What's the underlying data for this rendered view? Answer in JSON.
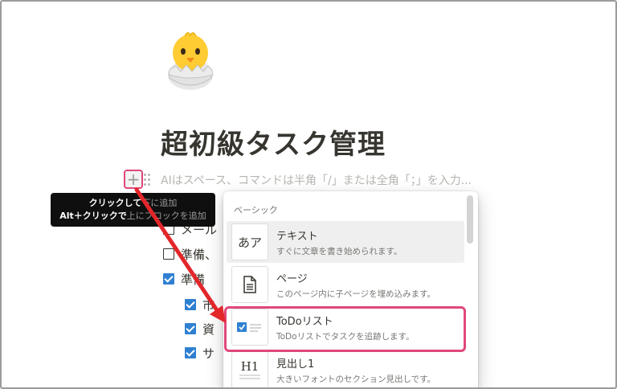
{
  "page": {
    "icon": "hatching-chick-icon",
    "title": "超初級タスク管理"
  },
  "editor": {
    "placeholder": "AIはスペース、コマンドは半角「/」または全角「；」を入力..."
  },
  "tooltip": {
    "line1_a": "クリックして",
    "line1_b": "下に追加",
    "line2_a": "Alt＋クリックで",
    "line2_b": "上にブロックを追加"
  },
  "todos": [
    {
      "text": "メール",
      "checked": false
    },
    {
      "text": "準備、",
      "checked": false
    },
    {
      "text": "準備",
      "checked": true
    },
    {
      "text": "市",
      "checked": true
    },
    {
      "text": "資",
      "checked": true
    },
    {
      "text": "サ",
      "checked": true
    }
  ],
  "menu": {
    "section_label": "ベーシック",
    "items": [
      {
        "title": "テキスト",
        "description": "すぐに文章を書き始められます。",
        "icon": "text-aa-icon",
        "thumb_text": "あア"
      },
      {
        "title": "ページ",
        "description": "このページ内に子ページを埋め込みます。",
        "icon": "page-icon"
      },
      {
        "title": "ToDoリスト",
        "description": "ToDoリストでタスクを追跡します。",
        "icon": "todo-checkbox-icon"
      },
      {
        "title": "見出し1",
        "description": "大きいフォントのセクション見出しです。",
        "icon": "heading1-icon",
        "thumb_text": "H1"
      }
    ]
  },
  "colors": {
    "accent_pink": "#e0477a",
    "arrow_red": "#e3262a",
    "checkbox_blue": "#2f80d1",
    "tooltip_bg": "#0f0f0f"
  }
}
